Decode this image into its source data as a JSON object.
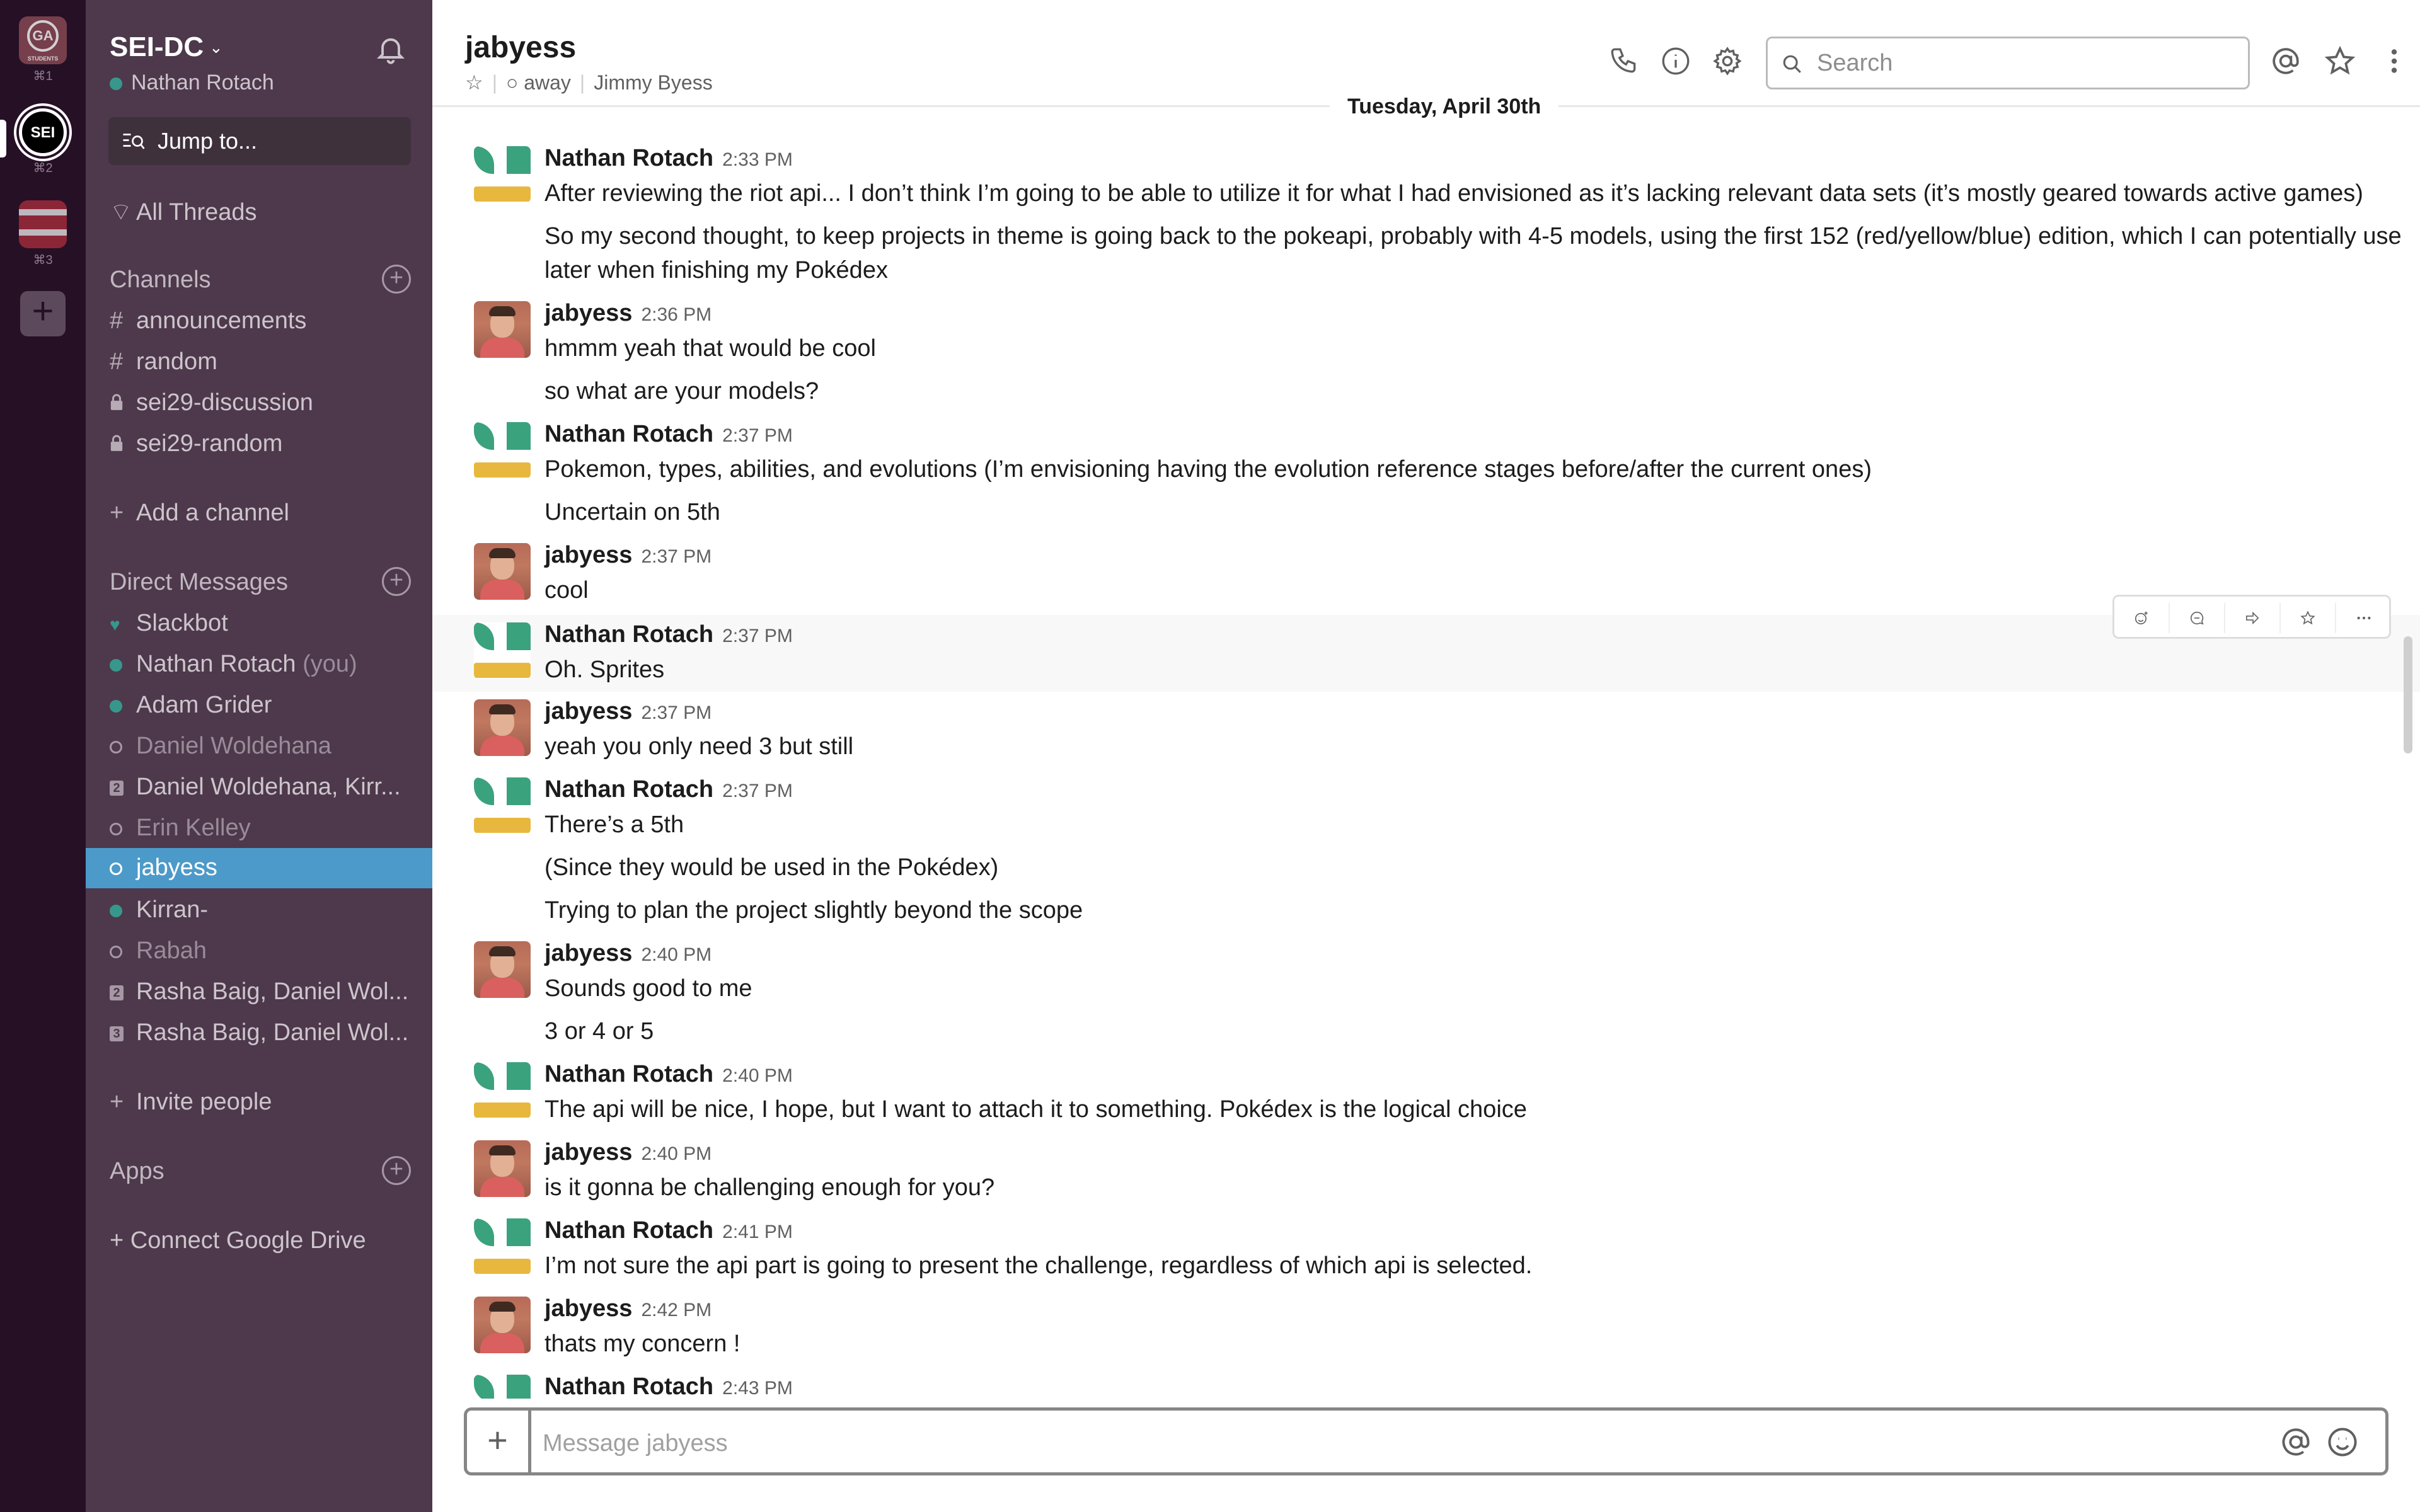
{
  "workspaces": [
    {
      "key": "⌘1",
      "abbr": "GA",
      "tag": "STUDENTS"
    },
    {
      "key": "⌘2",
      "abbr": "SEI"
    },
    {
      "key": "⌘3"
    }
  ],
  "sidebar": {
    "team_name": "SEI-DC",
    "user_name": "Nathan Rotach",
    "jump_label": "Jump to...",
    "all_threads": "All Threads",
    "channels_heading": "Channels",
    "channels": [
      {
        "prefix": "#",
        "name": "announcements"
      },
      {
        "prefix": "#",
        "name": "random"
      },
      {
        "prefix": "lock",
        "name": "sei29-discussion"
      },
      {
        "prefix": "lock",
        "name": "sei29-random"
      }
    ],
    "add_channel": "Add a channel",
    "dm_heading": "Direct Messages",
    "dms": [
      {
        "name": "Slackbot",
        "status": "heart"
      },
      {
        "name": "Nathan Rotach",
        "suffix": "(you)",
        "status": "online"
      },
      {
        "name": "Adam Grider",
        "status": "online"
      },
      {
        "name": "Daniel Woldehana",
        "status": "away"
      },
      {
        "name": "Daniel Woldehana, Kirr...",
        "status": "2"
      },
      {
        "name": "Erin Kelley",
        "status": "away"
      },
      {
        "name": "jabyess",
        "status": "away-active"
      },
      {
        "name": "Kirran-",
        "status": "online"
      },
      {
        "name": "Rabah",
        "status": "away"
      },
      {
        "name": "Rasha Baig, Daniel Wol...",
        "status": "2"
      },
      {
        "name": "Rasha Baig, Daniel Wol...",
        "status": "3"
      }
    ],
    "invite_people": "Invite people",
    "apps_heading": "Apps",
    "connect_drive": "+ Connect Google Drive"
  },
  "header": {
    "channel_name": "jabyess",
    "presence": "away",
    "full_name": "Jimmy Byess",
    "search_placeholder": "Search"
  },
  "date_divider": "Tuesday, April 30th",
  "messages": [
    {
      "author": "Nathan Rotach",
      "time": "2:33 PM",
      "avatar": "nr",
      "lines": [
        "After reviewing the riot api... I don’t think I’m going to be able to utilize it for what I had envisioned as it’s lacking relevant data sets (it’s mostly geared towards active games)",
        "So my second thought, to keep projects in theme is going back to the pokeapi, probably with 4-5 models, using the first 152 (red/yellow/blue) edition, which I can potentially use",
        "later when finishing my Pokédex"
      ]
    },
    {
      "author": "jabyess",
      "time": "2:36 PM",
      "avatar": "jb",
      "lines": [
        "hmmm yeah that would be cool",
        "so what are your models?"
      ]
    },
    {
      "author": "Nathan Rotach",
      "time": "2:37 PM",
      "avatar": "nr",
      "lines": [
        "Pokemon, types, abilities, and evolutions (I’m envisioning having the evolution reference stages before/after the current ones)",
        "Uncertain on 5th"
      ]
    },
    {
      "author": "jabyess",
      "time": "2:37 PM",
      "avatar": "jb",
      "lines": [
        "cool"
      ]
    },
    {
      "author": "Nathan Rotach",
      "time": "2:37 PM",
      "avatar": "nr",
      "lines": [
        "Oh. Sprites"
      ]
    },
    {
      "author": "jabyess",
      "time": "2:37 PM",
      "avatar": "jb",
      "lines": [
        "yeah you only need 3 but still"
      ]
    },
    {
      "author": "Nathan Rotach",
      "time": "2:37 PM",
      "avatar": "nr",
      "lines": [
        "There’s a 5th",
        "(Since they would be used in the Pokédex)",
        "Trying to plan the project slightly beyond the scope"
      ]
    },
    {
      "author": "jabyess",
      "time": "2:40 PM",
      "avatar": "jb",
      "lines": [
        "Sounds good to me",
        "3 or 4 or 5"
      ]
    },
    {
      "author": "Nathan Rotach",
      "time": "2:40 PM",
      "avatar": "nr",
      "lines": [
        "The api will be nice, I hope, but I want to attach it to something. Pokédex is the logical choice"
      ]
    },
    {
      "author": "jabyess",
      "time": "2:40 PM",
      "avatar": "jb",
      "lines": [
        "is it gonna be challenging enough for you?"
      ]
    },
    {
      "author": "Nathan Rotach",
      "time": "2:41 PM",
      "avatar": "nr",
      "lines": [
        "I’m not sure the api part is going to present the challenge, regardless of which api is selected."
      ]
    },
    {
      "author": "jabyess",
      "time": "2:42 PM",
      "avatar": "jb",
      "lines": [
        "thats my concern !"
      ]
    },
    {
      "author": "Nathan Rotach",
      "time": "2:43 PM",
      "avatar": "nr",
      "lines": []
    }
  ],
  "composer": {
    "placeholder": "Message jabyess"
  },
  "colors": {
    "sidebar_bg": "#4d394b",
    "rail_bg": "#261026",
    "active_item": "#4c9ac9",
    "online": "#38978d"
  }
}
